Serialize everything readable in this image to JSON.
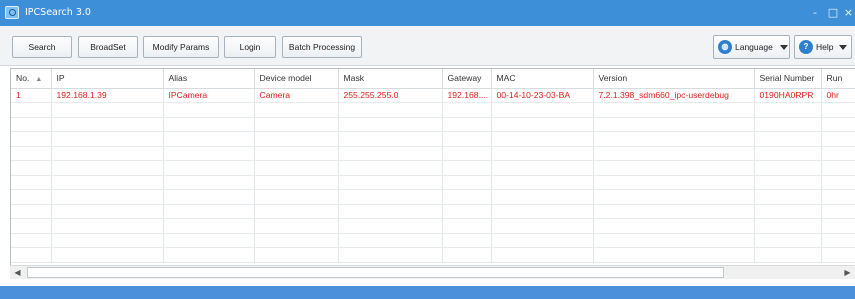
{
  "window": {
    "title": "IPCSearch 3.0",
    "minimize_glyph": "-",
    "maximize_glyph": "□",
    "close_glyph": "×"
  },
  "toolbar": {
    "buttons": [
      "Search",
      "BroadSet",
      "Modify Params",
      "Login",
      "Batch Processing"
    ],
    "language_label": "Language",
    "help_label": "Help",
    "language_icon": "globe-icon",
    "help_icon": "question-icon"
  },
  "table": {
    "sort_indicator": "▲",
    "columns": [
      "No.",
      "IP",
      "Alias",
      "Device model",
      "Mask",
      "Gateway",
      "MAC",
      "Version",
      "Serial Number",
      "Run"
    ],
    "rows": [
      [
        "1",
        "192.168.1.39",
        "IPCamera",
        "Camera",
        "255.255.255.0",
        "192.168....",
        "00-14-10-23-03-BA",
        "7.2.1.398_sdm660_ipc-userdebug",
        "0190HA0RPR",
        "0hr"
      ]
    ]
  },
  "scrollbar": {
    "left_glyph": "◀",
    "right_glyph": "▶"
  },
  "colors": {
    "titlebar": "#3d8fd8",
    "row_text": "#e0211b",
    "statusbar": "#4a90db"
  }
}
